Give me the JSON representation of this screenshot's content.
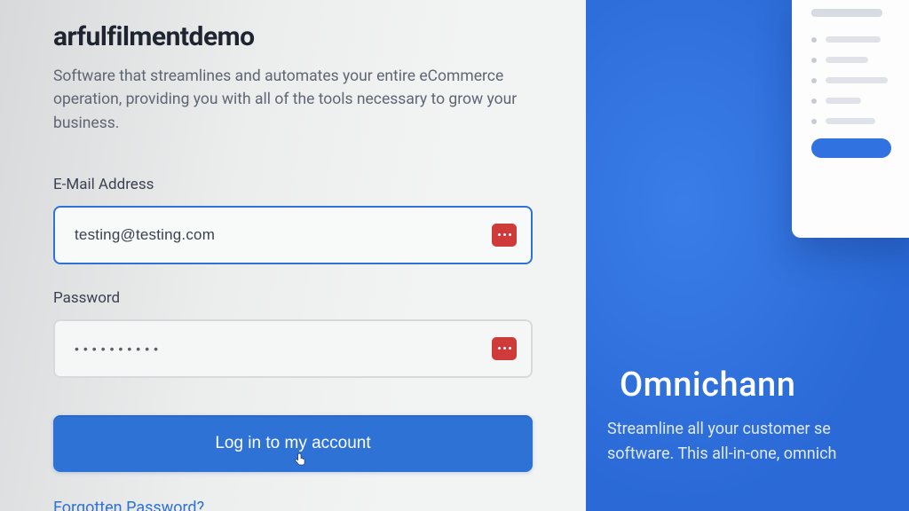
{
  "app": {
    "title": "arfulfilmentdemo",
    "subtitle": "Software that streamlines and automates your entire eCommerce operation, providing you with all of the tools necessary to grow your business."
  },
  "form": {
    "email_label": "E-Mail Address",
    "email_value": "testing@testing.com",
    "password_label": "Password",
    "password_value": "••••••••••",
    "login_button": "Log in to my account",
    "forgot_link": "Forgotten Password?"
  },
  "promo": {
    "title": "Omnichann",
    "line1": "Streamline all your customer se",
    "line2": "software. This all-in-one, omnich"
  },
  "colors": {
    "accent": "#2f72d6",
    "panel_blue": "#2f72e0",
    "badge_red": "#cf3a3a"
  }
}
